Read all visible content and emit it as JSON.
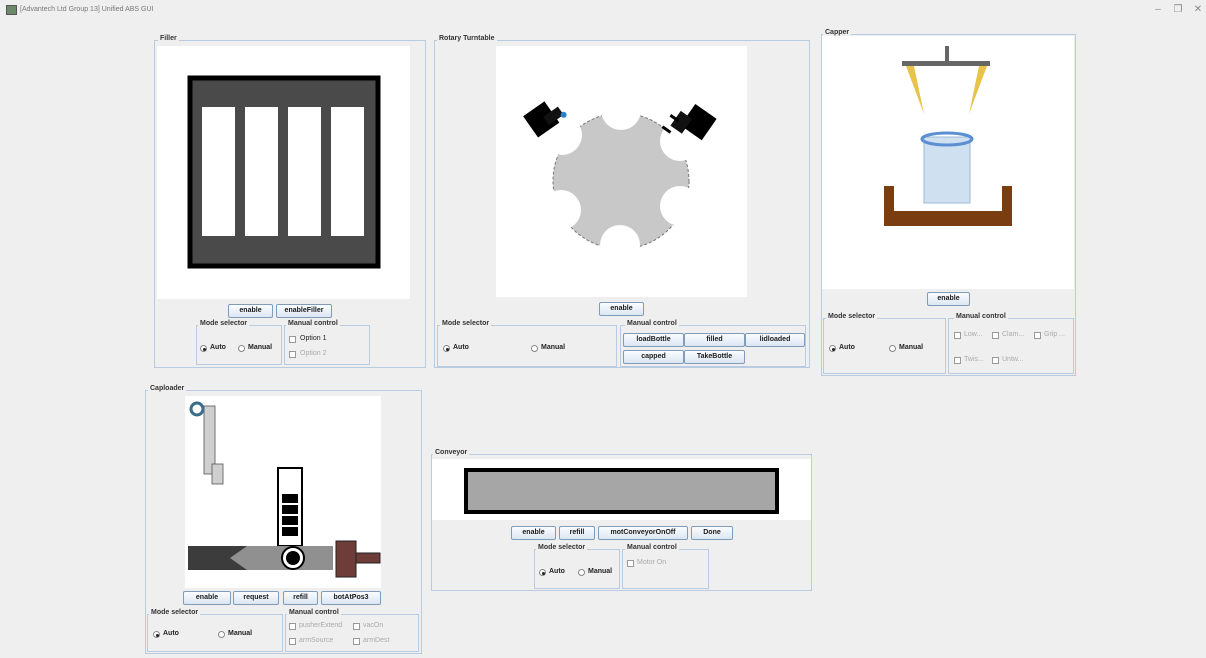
{
  "window": {
    "title": "[Advantech Ltd Group 13] Unified ABS GUI"
  },
  "filler": {
    "title": "Filler",
    "buttons": [
      "enable",
      "enableFiller"
    ],
    "mode_title": "Mode selector",
    "auto": "Auto",
    "manual": "Manual",
    "selected_mode": "Auto",
    "manual_title": "Manual control",
    "options": [
      "Option 1",
      "Option 2"
    ]
  },
  "turntable": {
    "title": "Rotary Turntable",
    "enable": "enable",
    "mode_title": "Mode selector",
    "auto": "Auto",
    "manual": "Manual",
    "selected_mode": "Auto",
    "manual_title": "Manual control",
    "buttons": [
      "loadBottle",
      "filled",
      "lidloaded",
      "capped",
      "TakeBottle"
    ]
  },
  "capper": {
    "title": "Capper",
    "enable": "enable",
    "mode_title": "Mode selector",
    "auto": "Auto",
    "manual": "Manual",
    "selected_mode": "Auto",
    "manual_title": "Manual control",
    "checks": [
      "Low...",
      "Clam...",
      "Grip ...",
      "Twis...",
      "Untw..."
    ]
  },
  "caploader": {
    "title": "Caploader",
    "buttons": [
      "enable",
      "request",
      "refill",
      "botAtPos3"
    ],
    "mode_title": "Mode selector",
    "auto": "Auto",
    "manual": "Manual",
    "selected_mode": "Auto",
    "manual_title": "Manual control",
    "checks": [
      "pusherExtend",
      "vacOn",
      "armSource",
      "armDest"
    ]
  },
  "conveyor": {
    "title": "Conveyor",
    "buttons": [
      "enable",
      "refill",
      "motConveyorOnOff",
      "Done"
    ],
    "mode_title": "Mode selector",
    "auto": "Auto",
    "manual": "Manual",
    "selected_mode": "Auto",
    "manual_title": "Manual control",
    "checks": [
      "Motor On"
    ]
  },
  "colors": {
    "panel_border": "#b9cbe0",
    "button_border": "#7f9db9",
    "cap_yellow": "#e8c34a",
    "capper_base": "#7a3d0f",
    "turntable_gray": "#c8c8c8",
    "conveyor_gray": "#a6a6a6",
    "bottle_blue": "#cfe0f0"
  }
}
